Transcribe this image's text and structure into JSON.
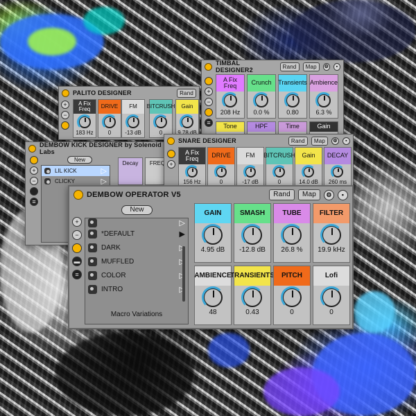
{
  "palito": {
    "title": "PALITO DESIGNER",
    "rand": "Rand",
    "macros": [
      {
        "label": "A Fix Freq",
        "value": "183 Hz",
        "color": "#3a3a3a",
        "text": "#ffffff"
      },
      {
        "label": "DRIVE",
        "value": "0",
        "color": "#f06a1a",
        "text": "#111111"
      },
      {
        "label": "FM",
        "value": "-13 dB",
        "color": "#dadada",
        "text": "#111111"
      },
      {
        "label": "BITCRUSH",
        "value": "0",
        "color": "#5fc4b6",
        "text": "#111111"
      },
      {
        "label": "Gain",
        "value": "9.78 dB",
        "color": "#f2e44a",
        "text": "#111111"
      }
    ]
  },
  "timbal": {
    "title": "TIMBAL DESIGNER2",
    "rand": "Rand",
    "map": "Map",
    "macros_top": [
      {
        "label": "A Fix Freq",
        "value": "208 Hz",
        "color": "#e07aff"
      },
      {
        "label": "Crunch",
        "value": "0.0 %",
        "color": "#66e08a"
      },
      {
        "label": "Transients",
        "value": "0.80",
        "color": "#58d4f2"
      },
      {
        "label": "Ambience",
        "value": "6.3 %",
        "color": "#d9a0e0"
      }
    ],
    "macros_bottom": [
      {
        "label": "Tone",
        "color": "#f2e44a"
      },
      {
        "label": "HPF",
        "color": "#b48ae0"
      },
      {
        "label": "Time",
        "color": "#c99ad9"
      },
      {
        "label": "Gain",
        "color": "#333333"
      }
    ]
  },
  "kick": {
    "title": "DEMBOW KICK DESIGNER by Solenoid Labs",
    "new": "New",
    "presets": [
      "LIL KICK",
      "CLICKY"
    ],
    "macros": [
      {
        "label": "Decay",
        "color": "#c8b4e0"
      },
      {
        "label": "FREQ",
        "color": "#cccccc"
      }
    ]
  },
  "snare": {
    "title": "SNARE DESIGNER",
    "rand": "Rand",
    "map": "Map",
    "macros": [
      {
        "label": "A Fix Freq",
        "value": "156 Hz",
        "color": "#3a3a3a",
        "text": "#ffffff"
      },
      {
        "label": "DRIVE",
        "value": "0",
        "color": "#f06a1a",
        "text": "#111111"
      },
      {
        "label": "FM",
        "value": "-17 dB",
        "color": "#dadada",
        "text": "#111111"
      },
      {
        "label": "BITCRUSH",
        "value": "0",
        "color": "#5fc4b6",
        "text": "#111111"
      },
      {
        "label": "Gain",
        "value": "14.0 dB",
        "color": "#f2e44a",
        "text": "#111111"
      },
      {
        "label": "DECAY",
        "value": "260 ms",
        "color": "#b48ae0",
        "text": "#111111"
      }
    ]
  },
  "main": {
    "title": "DEMBOW OPERATOR V5",
    "rand": "Rand",
    "map": "Map",
    "new": "New",
    "presets": [
      {
        "name": "",
        "active": false
      },
      {
        "name": "*DEFAULT",
        "active": true
      },
      {
        "name": "DARK",
        "active": false
      },
      {
        "name": "MUFFLED",
        "active": false
      },
      {
        "name": "COLOR",
        "active": false
      },
      {
        "name": "INTRO",
        "active": false
      }
    ],
    "footer": "Macro Variations",
    "macros": [
      {
        "label": "GAIN",
        "value": "4.95 dB",
        "color": "#5fd6f2"
      },
      {
        "label": "SMASH",
        "value": "-12.8 dB",
        "color": "#66e08a"
      },
      {
        "label": "TUBE",
        "value": "26.8 %",
        "color": "#d98ae8"
      },
      {
        "label": "FILTER",
        "value": "19.9 kHz",
        "color": "#f29a6a"
      },
      {
        "label": "AMBIENCE",
        "value": "48",
        "color": "#dcdcdc"
      },
      {
        "label": "TRANSIENTS",
        "value": "0.43",
        "color": "#f2e44a"
      },
      {
        "label": "PITCH",
        "value": "0",
        "color": "#f06a1a"
      },
      {
        "label": "Lofi",
        "value": "0",
        "color": "#dcdcdc"
      }
    ]
  }
}
